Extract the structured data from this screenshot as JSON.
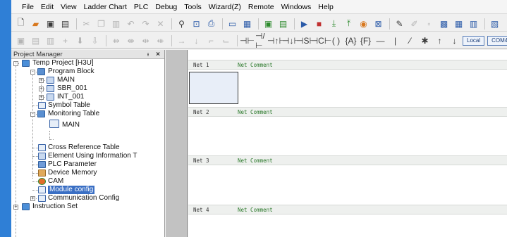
{
  "menu": [
    "File",
    "Edit",
    "View",
    "Ladder Chart",
    "PLC",
    "Debug",
    "Tools",
    "Wizard(Z)",
    "Remote",
    "Windows",
    "Help"
  ],
  "toolbar": {
    "local_label": "Local",
    "port_label": "COM4"
  },
  "project_manager": {
    "title": "Project Manager",
    "pin_glyph": "ᵻ",
    "close_glyph": "×",
    "tree": {
      "root": "Temp Project [H3U]",
      "program_block": "Program Block",
      "main": "MAIN",
      "sbr": "SBR_001",
      "int": "INT_001",
      "symbol_table": "Symbol Table",
      "monitoring_table": "Monitoring Table",
      "monitoring_main": "MAIN",
      "cross_reference": "Cross Reference Table",
      "element_using": "Element Using Information T",
      "plc_parameter": "PLC Parameter",
      "device_memory": "Device Memory",
      "cam": "CAM",
      "module_config": "Module config",
      "communication_config": "Communication Config",
      "instruction_set": "Instruction Set"
    }
  },
  "ladder": {
    "nets": [
      {
        "label": "Net 1",
        "comment": "Net Comment"
      },
      {
        "label": "Net 2",
        "comment": "Net Comment"
      },
      {
        "label": "Net 3",
        "comment": "Net Comment"
      },
      {
        "label": "Net 4",
        "comment": "Net Comment"
      }
    ]
  },
  "colors": {
    "accent_strip": "#2f7fd6",
    "selection": "#3a6fc4",
    "net_comment": "#2d7a2d"
  }
}
